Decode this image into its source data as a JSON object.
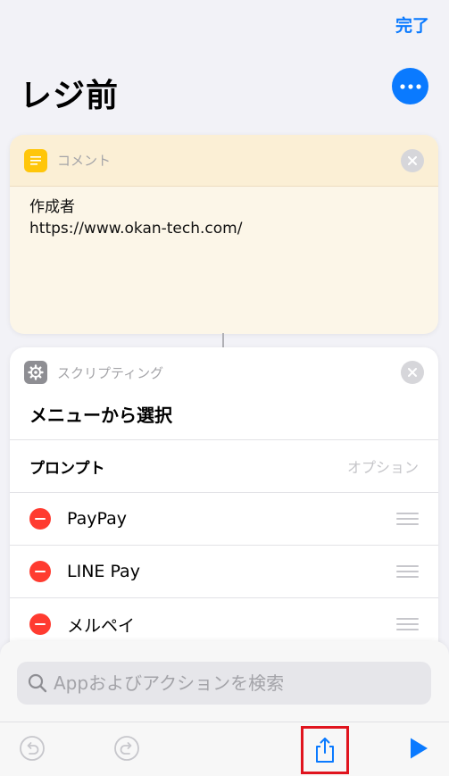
{
  "header": {
    "done_label": "完了",
    "title": "レジ前"
  },
  "comment": {
    "label": "コメント",
    "lines": [
      "作成者",
      "https://www.okan-tech.com/"
    ]
  },
  "menu": {
    "category": "スクリプティング",
    "title": "メニューから選択",
    "prompt_label": "プロンプト",
    "prompt_value": "オプション",
    "items": [
      {
        "label": "PayPay"
      },
      {
        "label": "LINE Pay"
      },
      {
        "label": "メルペイ"
      }
    ]
  },
  "search": {
    "placeholder": "Appおよびアクションを検索"
  },
  "colors": {
    "accent": "#0a7aff",
    "remove": "#ff3b30",
    "highlight": "#e0141e"
  }
}
